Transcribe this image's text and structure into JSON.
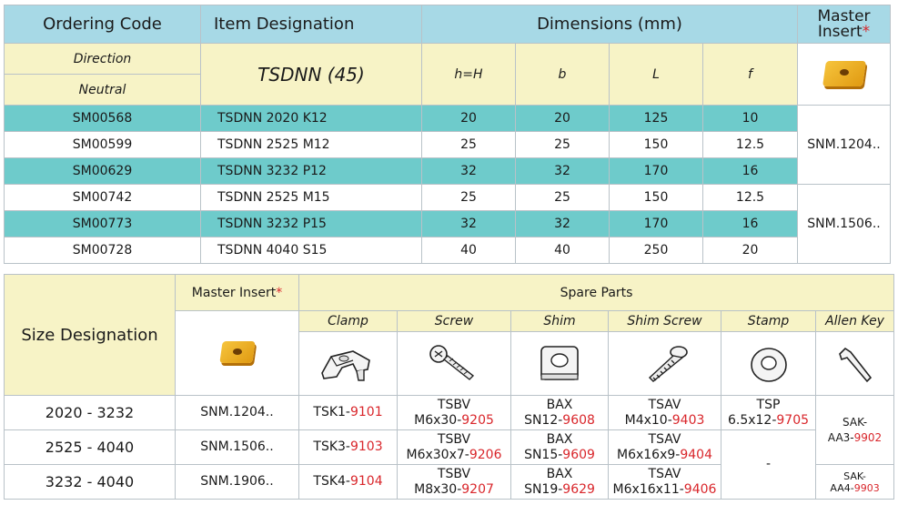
{
  "table1": {
    "headers": {
      "ordering_code": "Ordering Code",
      "item_designation": "Item Designation",
      "dimensions": "Dimensions (mm)",
      "master_insert_line1": "Master",
      "master_insert_line2": "Insert",
      "star": "*"
    },
    "direction_label": "Direction",
    "neutral_label": "Neutral",
    "series_label": "TSDNN (45)",
    "dim_cols": [
      "h=H",
      "b",
      "L",
      "f"
    ],
    "rows": [
      {
        "code": "SM00568",
        "item": "TSDNN 2020 K12",
        "h": "20",
        "b": "20",
        "L": "125",
        "f": "10"
      },
      {
        "code": "SM00599",
        "item": "TSDNN 2525 M12",
        "h": "25",
        "b": "25",
        "L": "150",
        "f": "12.5"
      },
      {
        "code": "SM00629",
        "item": "TSDNN 3232 P12",
        "h": "32",
        "b": "32",
        "L": "170",
        "f": "16"
      },
      {
        "code": "SM00742",
        "item": "TSDNN 2525 M15",
        "h": "25",
        "b": "25",
        "L": "150",
        "f": "12.5"
      },
      {
        "code": "SM00773",
        "item": "TSDNN 3232 P15",
        "h": "32",
        "b": "32",
        "L": "170",
        "f": "16"
      },
      {
        "code": "SM00728",
        "item": "TSDNN 4040 S15",
        "h": "40",
        "b": "40",
        "L": "250",
        "f": "20"
      }
    ],
    "insert_groups": [
      "SNM.1204..",
      "SNM.1506.."
    ]
  },
  "table2": {
    "size_designation": "Size Designation",
    "master_insert": "Master Insert",
    "star": "*",
    "spare_parts": "Spare Parts",
    "part_cols": [
      "Clamp",
      "Screw",
      "Shim",
      "Shim Screw",
      "Stamp",
      "Allen Key"
    ],
    "icons": {
      "clamp": "clamp-icon",
      "screw": "screw-icon",
      "shim": "shim-icon",
      "shim_screw": "shim-screw-icon",
      "stamp": "washer-icon",
      "allen_key": "allen-key-icon"
    },
    "rows": [
      {
        "size": "2020 - 3232",
        "insert": "SNM.1204..",
        "clamp": {
          "p": "TSK1-",
          "n": "9101"
        },
        "screw": {
          "l1": "TSBV",
          "p": "M6x30-",
          "n": "9205"
        },
        "shim": {
          "l1": "BAX",
          "p": "SN12-",
          "n": "9608"
        },
        "shim_screw": {
          "l1": "TSAV",
          "p": "M4x10-",
          "n": "9403"
        },
        "stamp": {
          "l1": "TSP",
          "p": "6.5x12-",
          "n": "9705"
        }
      },
      {
        "size": "2525 - 4040",
        "insert": "SNM.1506..",
        "clamp": {
          "p": "TSK3-",
          "n": "9103"
        },
        "screw": {
          "l1": "TSBV",
          "p": "M6x30x7-",
          "n": "9206"
        },
        "shim": {
          "l1": "BAX",
          "p": "SN15-",
          "n": "9609"
        },
        "shim_screw": {
          "l1": "TSAV",
          "p": "M6x16x9-",
          "n": "9404"
        }
      },
      {
        "size": "3232 - 4040",
        "insert": "SNM.1906..",
        "clamp": {
          "p": "TSK4-",
          "n": "9104"
        },
        "screw": {
          "l1": "TSBV",
          "p": "M8x30-",
          "n": "9207"
        },
        "shim": {
          "l1": "BAX",
          "p": "SN19-",
          "n": "9629"
        },
        "shim_screw": {
          "l1": "TSAV",
          "p": "M6x16x11-",
          "n": "9406"
        }
      }
    ],
    "stamp_dash": "-",
    "allen_keys": [
      {
        "l1": "SAK-",
        "p": "AA3-",
        "n": "9902"
      },
      {
        "l1": "SAK-",
        "p": "AA4-",
        "n": "9903"
      }
    ]
  },
  "colors": {
    "header_blue": "#a7d9e6",
    "header_cream": "#f7f3c6",
    "row_teal": "#6ecbcb",
    "accent_red": "#d9262b",
    "insert_gold": "#f0b22a"
  }
}
